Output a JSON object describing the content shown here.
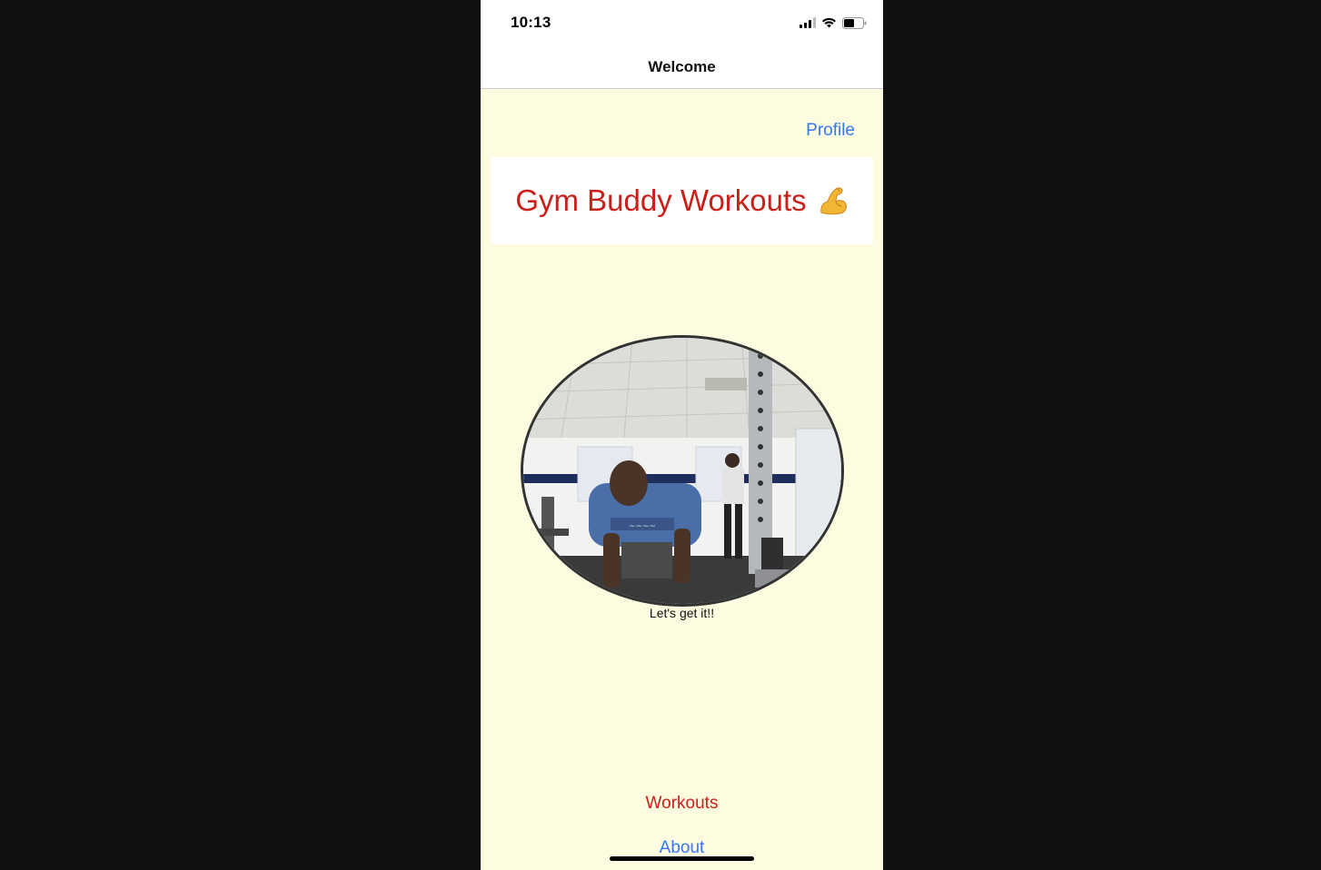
{
  "status_bar": {
    "time": "10:13",
    "signal_icon": "cellular-signal-icon",
    "wifi_icon": "wifi-icon",
    "battery_icon": "battery-icon",
    "battery_level": 0.5
  },
  "nav": {
    "title": "Welcome"
  },
  "header": {
    "profile_label": "Profile",
    "title": "Gym Buddy Workouts",
    "title_icon": "flexed-biceps-icon"
  },
  "main": {
    "photo": "gym-photo",
    "caption": "Let's get it!!"
  },
  "footer": {
    "workouts_label": "Workouts",
    "about_label": "About"
  },
  "colors": {
    "background": "#fdfbe0",
    "accent_red": "#cc1f1a",
    "link_blue": "#3478f6"
  }
}
